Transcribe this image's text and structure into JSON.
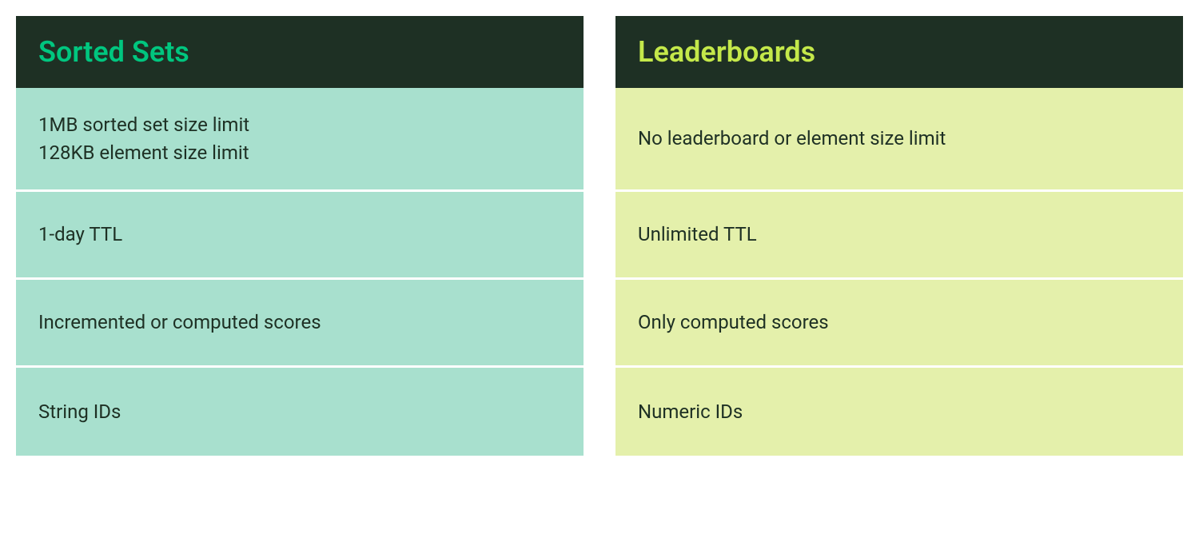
{
  "columns": [
    {
      "title": "Sorted Sets",
      "rows": [
        "1MB sorted set size limit\n128KB element size limit",
        "1-day TTL",
        "Incremented or computed scores",
        "String IDs"
      ]
    },
    {
      "title": "Leaderboards",
      "rows": [
        "No leaderboard or element size limit",
        "Unlimited TTL",
        "Only computed scores",
        "Numeric IDs"
      ]
    }
  ]
}
